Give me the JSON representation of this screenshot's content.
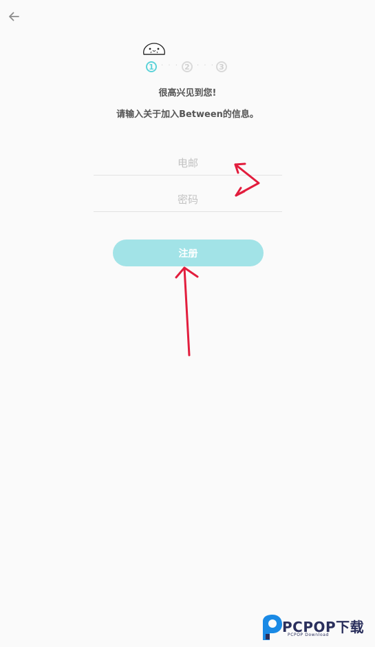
{
  "header": {
    "back_icon": "arrow-left-icon"
  },
  "stepper": {
    "mascot_icon": "mascot-face-icon",
    "steps": [
      "1",
      "2",
      "3"
    ],
    "current_step": 1,
    "separator": "· · ·"
  },
  "intro": {
    "greeting": "很高兴见到您!",
    "subtitle": "请输入关于加入Between的信息。"
  },
  "form": {
    "email_placeholder": "电邮",
    "email_value": "",
    "password_placeholder": "密码",
    "password_value": "",
    "submit_label": "注册"
  },
  "watermark": {
    "brand": "PCPOP下载",
    "tagline": "PCPOP Download"
  },
  "colors": {
    "accent": "#5dd3d9",
    "button_bg": "#a2e3e7",
    "annotation": "#e21d3d"
  }
}
